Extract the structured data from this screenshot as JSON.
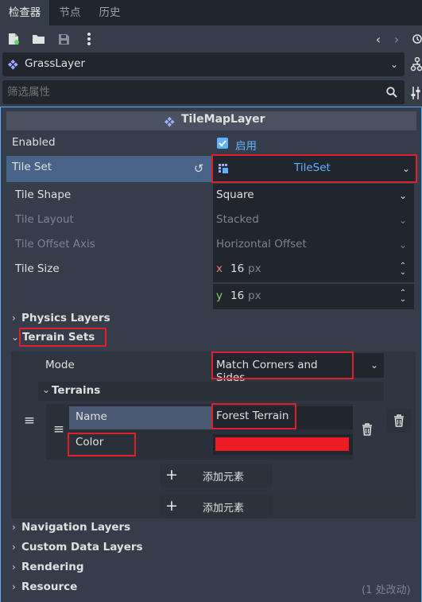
{
  "tabs": [
    {
      "label": "检查器",
      "active": true
    },
    {
      "label": "节点",
      "active": false
    },
    {
      "label": "历史",
      "active": false
    }
  ],
  "node_selector": {
    "name": "GrassLayer"
  },
  "filter": {
    "placeholder": "筛选属性"
  },
  "header": {
    "title": "TileMapLayer"
  },
  "enabled": {
    "label": "Enabled",
    "checkbox_label": "启用",
    "checked": true
  },
  "tile_set": {
    "label": "Tile Set",
    "value": "TileSet"
  },
  "tile_shape": {
    "label": "Tile Shape",
    "value": "Square"
  },
  "tile_layout": {
    "label": "Tile Layout",
    "value": "Stacked"
  },
  "tile_offset_axis": {
    "label": "Tile Offset Axis",
    "value": "Horizontal Offset"
  },
  "tile_size": {
    "label": "Tile Size",
    "x_label": "x",
    "x_value": "16",
    "y_label": "y",
    "y_value": "16",
    "unit": "px"
  },
  "sections": {
    "physics_layers": "Physics Layers",
    "terrain_sets": "Terrain Sets",
    "navigation_layers": "Navigation Layers",
    "custom_data_layers": "Custom Data Layers",
    "rendering": "Rendering",
    "resource": "Resource",
    "resource_note": "(1 处改动)"
  },
  "terrain": {
    "mode_label": "Mode",
    "mode_value": "Match Corners and Sides",
    "terrains_label": "Terrains",
    "name_label": "Name",
    "name_value": "Forest Terrain",
    "color_label": "Color",
    "color_value": "#ec1b24",
    "add_element_inner": "添加元素",
    "add_element_outer": "添加元素"
  },
  "colors": {
    "accent": "#5fb2ff",
    "highlight": "#e0202a",
    "selected_row": "#4a6488"
  }
}
